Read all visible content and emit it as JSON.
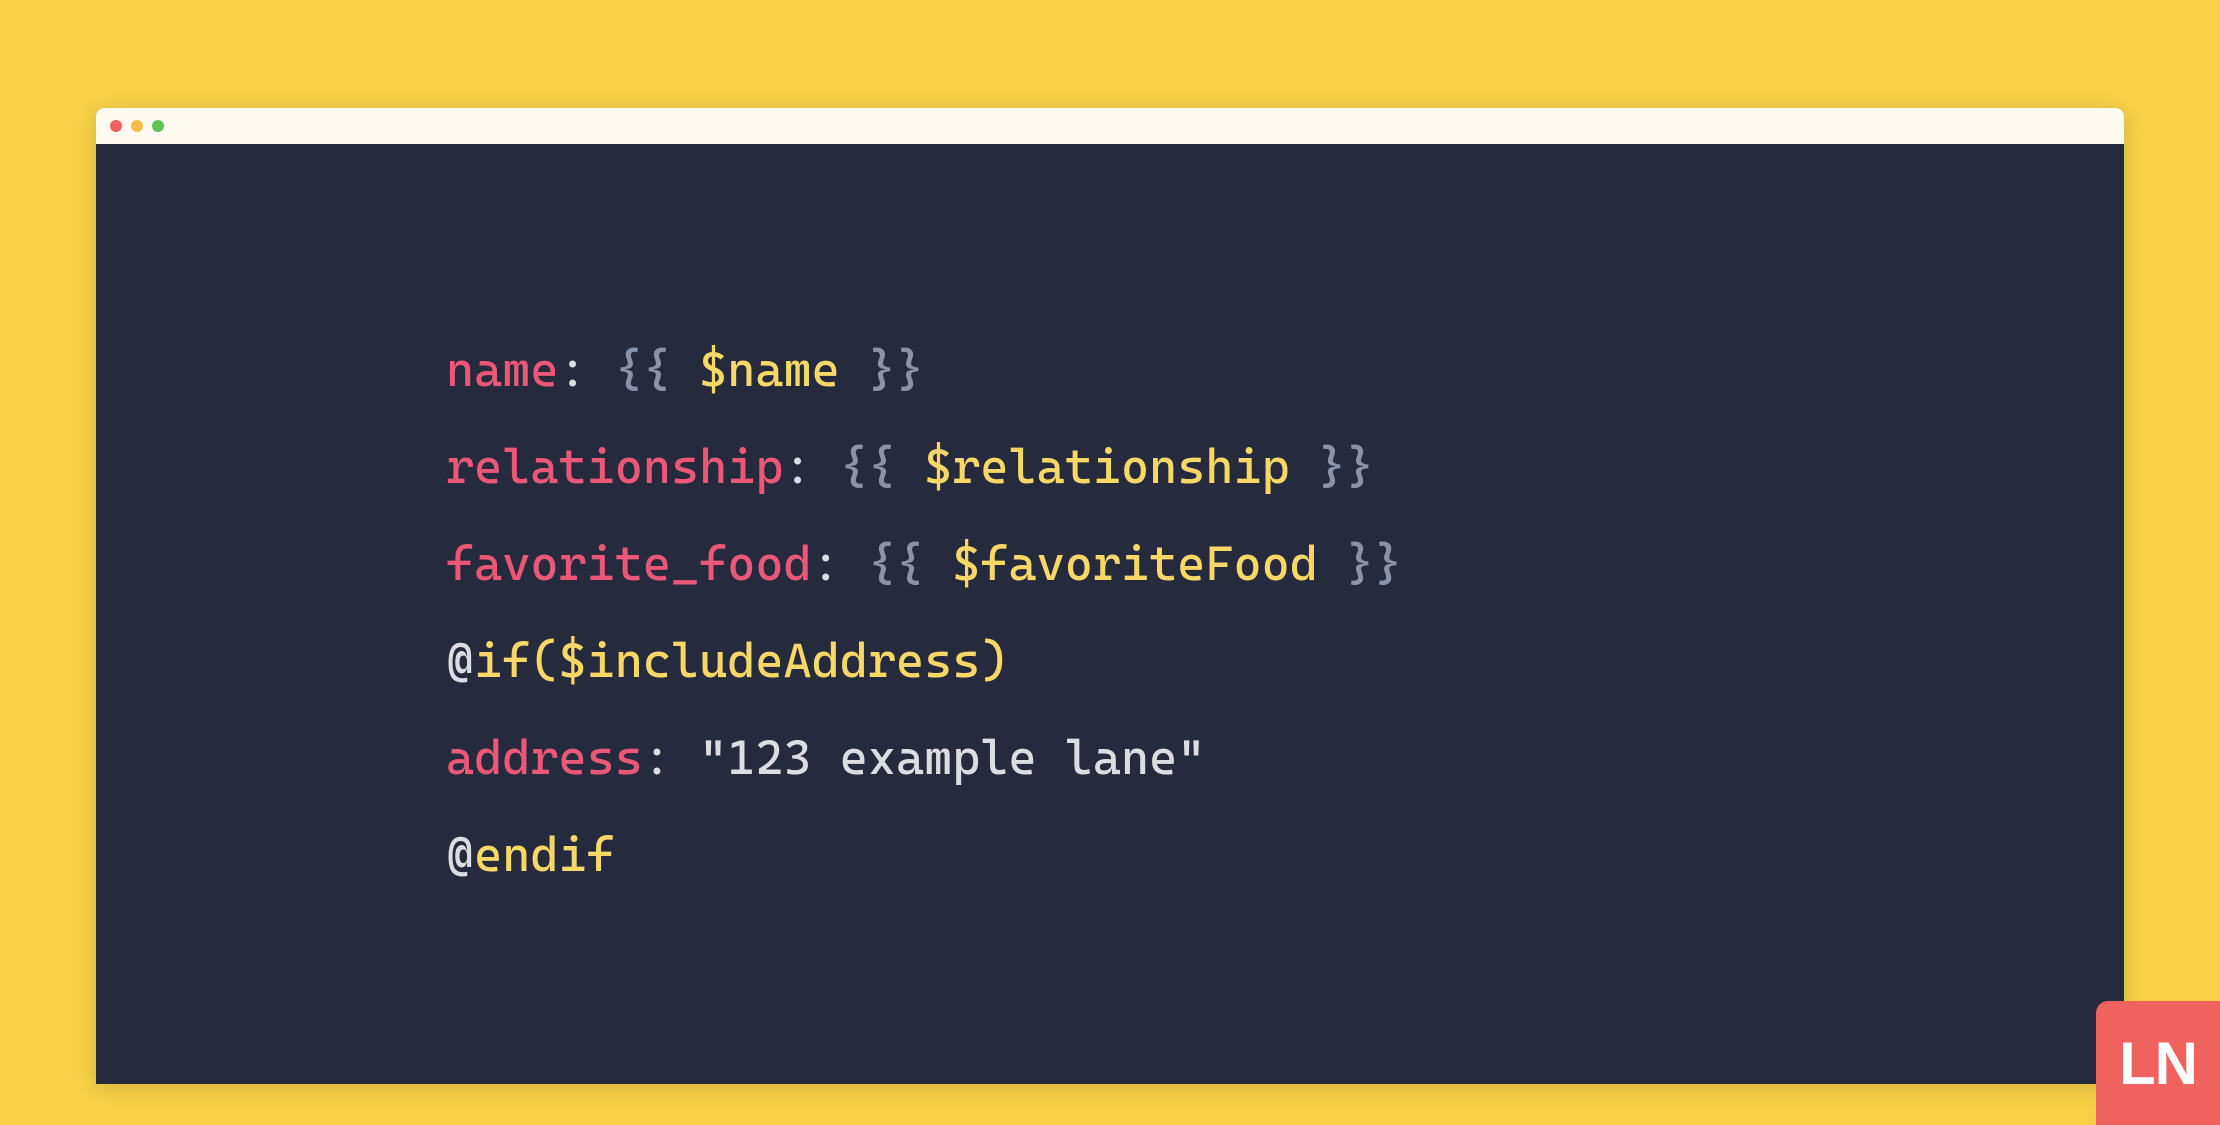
{
  "window": {
    "dot_colors": [
      "#f0625d",
      "#f6bd46",
      "#5dc355"
    ]
  },
  "code": {
    "lines": [
      {
        "key": "name",
        "brace_open": "{{",
        "var": "$name",
        "brace_close": "}}"
      },
      {
        "key": "relationship",
        "brace_open": "{{",
        "var": "$relationship",
        "brace_close": "}}"
      },
      {
        "key": "favorite_food",
        "brace_open": "{{",
        "var": "$favoriteFood",
        "brace_close": "}}"
      }
    ],
    "if_at": "@",
    "if_keyword": "if",
    "if_paren_open": "(",
    "if_var": "$includeAddress",
    "if_paren_close": ")",
    "address_key": "address",
    "address_value": "\"123 example lane\"",
    "endif_at": "@",
    "endif_keyword": "endif"
  },
  "logo": {
    "text": "LN"
  }
}
